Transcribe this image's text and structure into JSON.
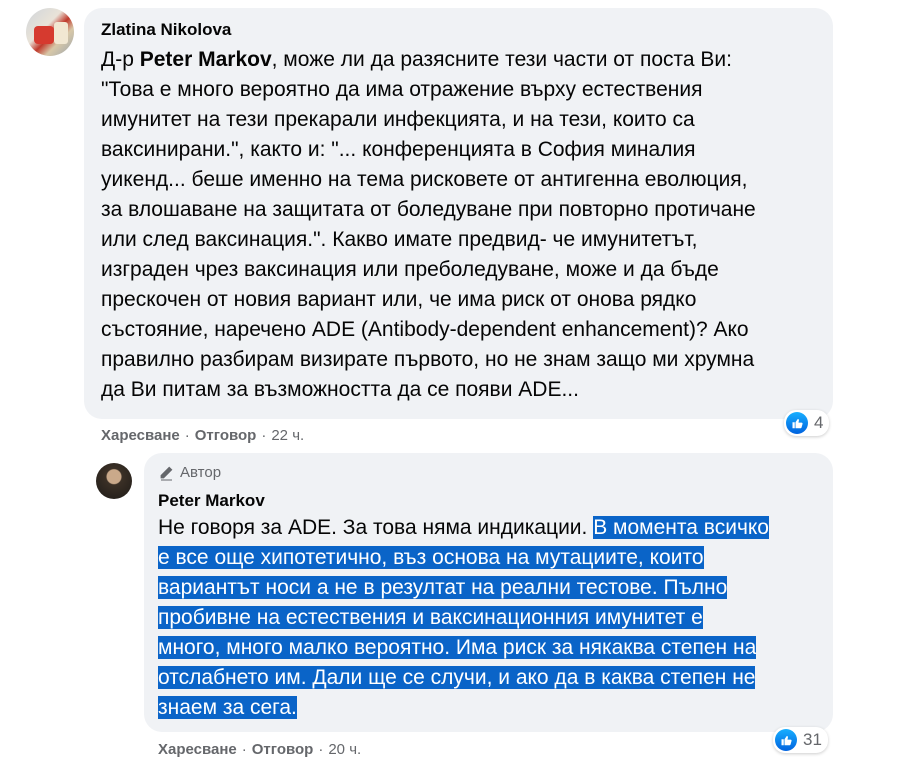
{
  "comment1": {
    "author": "Zlatina Nikolova",
    "lines": [
      [
        "Д-р ",
        "Peter Markov",
        ", може ли да разясните тези части от поста Ви:"
      ],
      "\"Това е много вероятно да има отражение върху естествения",
      "имунитет на тези прекарали инфекцията, и на тези, които са",
      "ваксинирани.\", както и: \"... конференцията в София миналия",
      "уикенд... беше именно на тема рисковете от антигенна еволюция,",
      "за влошаване на защитата от боледуване при повторно протичане",
      "или след ваксинация.\". Какво имате предвид- че имунитетът,",
      "изграден чрез ваксинация или преболедуване, може и да бъде",
      "прескочен от новия вариант или, че има риск от онова рядко",
      "състояние, наречено ADE (Antibody-dependent enhancement)? Ако",
      "правилно разбирам визирате първото, но не знам защо ми хрумна",
      "да Ви питам за възможността да се появи ADE..."
    ],
    "actions": {
      "like": "Харесване",
      "reply": "Отговор",
      "time": "22 ч."
    },
    "reaction_count": "4"
  },
  "comment2": {
    "badge": "Автор",
    "author": "Peter Markov",
    "line1_plain": "Не говоря за ADE. За това няма индикации. ",
    "line1_selected": "В момента всичко",
    "selected_lines": [
      "е все още хипотетично, въз основа на мутациите, които",
      "вариантът носи а не в резултат на реални тестове. Пълно",
      "пробивне на естествения и ваксинационния имунитет е",
      "много, много малко вероятно. Има риск за някаква степен на",
      "отслабнето им. Дали ще се случи, и ако да в каква степен не",
      "знаем за сега."
    ],
    "actions": {
      "like": "Харесване",
      "reply": "Отговор",
      "time": "20 ч."
    },
    "reaction_count": "31"
  },
  "colors": {
    "bubble": "#f0f2f5",
    "selection": "#0a64c8",
    "like_blue": "#1877f2",
    "meta_gray": "#65676b"
  },
  "icons": {
    "pencil": "pencil-icon",
    "like": "like-icon"
  }
}
